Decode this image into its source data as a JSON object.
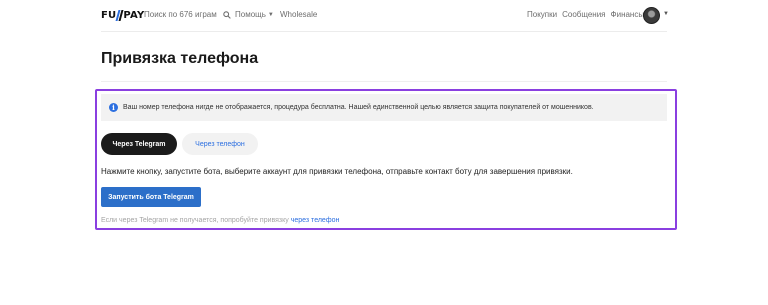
{
  "header": {
    "logo_left": "FU",
    "logo_right": "PAY",
    "search_label": "Поиск по 676 играм",
    "help_label": "Помощь",
    "wholesale_label": "Wholesale",
    "purchases_label": "Покупки",
    "sales_label": "Сообщения",
    "finance_label": "Финансы"
  },
  "page": {
    "title": "Привязка телефона"
  },
  "notice": {
    "text": "Ваш номер телефона нигде не отображается, процедура бесплатна. Нашей единственной целью является защита покупателей от мошенников."
  },
  "tabs": [
    {
      "label": "Через Telegram",
      "active": true
    },
    {
      "label": "Через телефон",
      "active": false
    }
  ],
  "instruction": "Нажмите кнопку, запустите бота, выберите аккаунт для привязки телефона, отправьте контакт боту для завершения привязки.",
  "launch_button": "Запустить бота Telegram",
  "footnote": {
    "text": "Если через Telegram не получается, попробуйте привязку ",
    "link": "через телефон"
  },
  "colors": {
    "accent": "#2c6fe0",
    "highlight_border": "#8a3fe0",
    "button": "#2c6fc9"
  }
}
